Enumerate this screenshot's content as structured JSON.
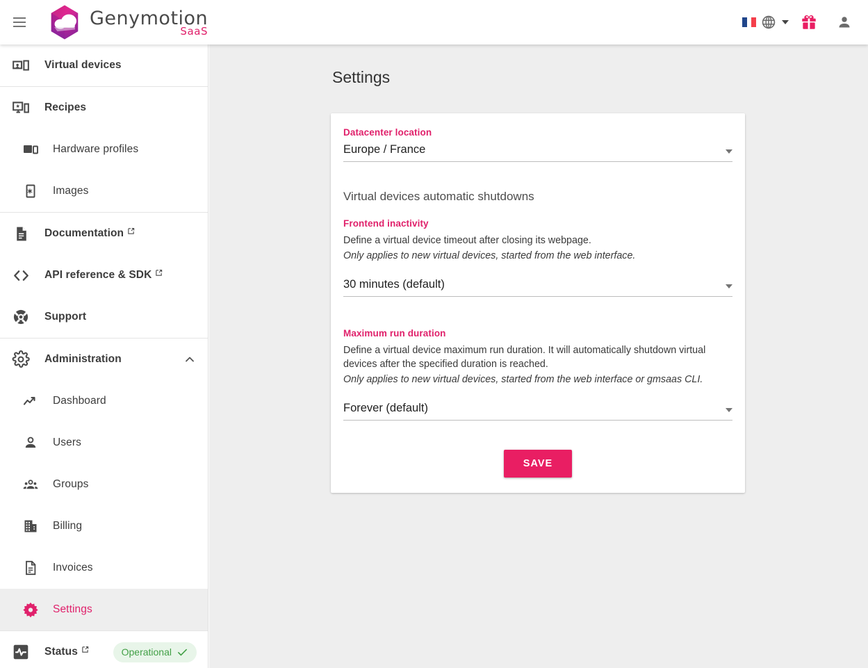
{
  "brand": {
    "name": "Genymotion",
    "sub": "SaaS",
    "accent": "#e0216b",
    "logo_icon": "genymotion-cloud-hexagon-logo"
  },
  "topbar": {
    "menu_icon": "hamburger-menu-icon",
    "language": {
      "flag_icon": "flag-france-icon",
      "globe_icon": "globe-icon",
      "caret_icon": "chevron-down-icon"
    },
    "gift_icon": "gift-icon",
    "account_icon": "person-account-icon"
  },
  "sidebar": {
    "groups": [
      {
        "items": [
          {
            "label": "Virtual devices",
            "icon": "devices-icon",
            "sub": false,
            "external": false,
            "active": false
          }
        ]
      },
      {
        "items": [
          {
            "label": "Recipes",
            "icon": "recipes-desktop-mobile-star-icon",
            "sub": false,
            "external": false,
            "active": false
          },
          {
            "label": "Hardware profiles",
            "icon": "tablet-phone-icon",
            "sub": true,
            "external": false,
            "active": false
          },
          {
            "label": "Images",
            "icon": "phone-gear-icon",
            "sub": true,
            "external": false,
            "active": false
          }
        ]
      },
      {
        "items": [
          {
            "label": "Documentation",
            "icon": "document-icon",
            "sub": false,
            "external": true,
            "active": false
          },
          {
            "label": "API reference & SDK",
            "icon": "code-brackets-icon",
            "sub": false,
            "external": true,
            "active": false
          },
          {
            "label": "Support",
            "icon": "lifebuoy-icon",
            "sub": false,
            "external": false,
            "active": false
          }
        ]
      },
      {
        "items": [
          {
            "label": "Administration",
            "icon": "gear-icon",
            "sub": false,
            "external": false,
            "active": false,
            "expanded": true,
            "chevron": "chevron-up-icon"
          },
          {
            "label": "Dashboard",
            "icon": "trending-up-icon",
            "sub": true,
            "external": false,
            "active": false
          },
          {
            "label": "Users",
            "icon": "person-icon",
            "sub": true,
            "external": false,
            "active": false
          },
          {
            "label": "Groups",
            "icon": "people-group-icon",
            "sub": true,
            "external": false,
            "active": false
          },
          {
            "label": "Billing",
            "icon": "building-icon",
            "sub": true,
            "external": false,
            "active": false
          },
          {
            "label": "Invoices",
            "icon": "invoice-document-icon",
            "sub": true,
            "external": false,
            "active": false
          },
          {
            "label": "Settings",
            "icon": "gear-filled-icon",
            "sub": true,
            "external": false,
            "active": true
          }
        ]
      },
      {
        "items": [
          {
            "label": "Status",
            "icon": "pulse-activity-icon",
            "sub": false,
            "external": true,
            "active": false,
            "badge": {
              "label": "Operational",
              "icon": "check-icon",
              "bg": "#e8f5e9",
              "color": "#43a047"
            }
          }
        ]
      }
    ]
  },
  "main": {
    "page_title": "Settings",
    "datacenter": {
      "label": "Datacenter location",
      "value": "Europe / France",
      "caret_icon": "dropdown-caret-icon"
    },
    "shutdowns": {
      "section_title": "Virtual devices automatic shutdowns",
      "frontend": {
        "label": "Frontend inactivity",
        "description": "Define a virtual device timeout after closing its webpage.",
        "note": "Only applies to new virtual devices, started from the web interface.",
        "value": "30 minutes (default)",
        "caret_icon": "dropdown-caret-icon"
      },
      "max_run": {
        "label": "Maximum run duration",
        "description": "Define a virtual device maximum run duration. It will automatically shutdown virtual devices after the specified duration is reached.",
        "note": "Only applies to new virtual devices, started from the web interface or gmsaas CLI.",
        "value": "Forever (default)",
        "caret_icon": "dropdown-caret-icon"
      }
    },
    "save_label": "SAVE",
    "save_color": "#e91e63"
  }
}
